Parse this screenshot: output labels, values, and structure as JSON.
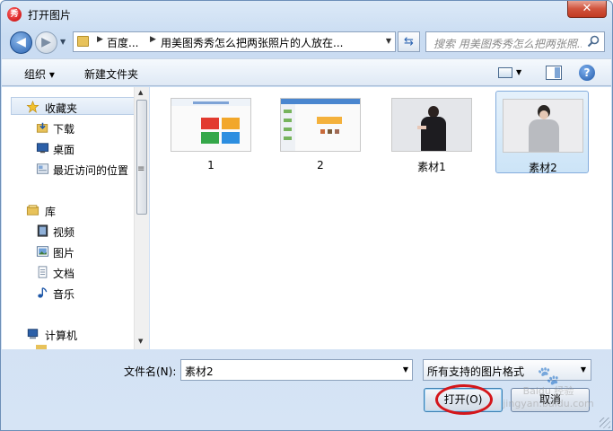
{
  "window": {
    "title": "打开图片",
    "app_icon_label": "秀",
    "close_label": "✕"
  },
  "address": {
    "segments": [
      "百度...",
      "用美图秀秀怎么把两张照片的人放在..."
    ]
  },
  "search": {
    "placeholder": "搜索 用美图秀秀怎么把两张照..."
  },
  "toolbar": {
    "organize_label": "组织 ▾",
    "new_folder_label": "新建文件夹"
  },
  "sidebar": {
    "favorites": {
      "label": "收藏夹",
      "icon": "star-icon"
    },
    "fav_items": [
      {
        "label": "下载",
        "icon": "download-folder-icon"
      },
      {
        "label": "桌面",
        "icon": "desktop-icon"
      },
      {
        "label": "最近访问的位置",
        "icon": "recent-places-icon"
      }
    ],
    "libraries": {
      "label": "库",
      "icon": "library-icon"
    },
    "lib_items": [
      {
        "label": "视频",
        "icon": "video-icon"
      },
      {
        "label": "图片",
        "icon": "pictures-icon"
      },
      {
        "label": "文档",
        "icon": "documents-icon"
      },
      {
        "label": "音乐",
        "icon": "music-icon"
      }
    ],
    "computer": {
      "label": "计算机",
      "icon": "computer-icon"
    },
    "scroll_marker": "≡"
  },
  "files": [
    {
      "name": "1",
      "kind": "screenshot-colorful-buttons"
    },
    {
      "name": "2",
      "kind": "screenshot-app-ui"
    },
    {
      "name": "素材1",
      "kind": "photo-woman"
    },
    {
      "name": "素材2",
      "kind": "photo-man",
      "selected": true
    }
  ],
  "bottom": {
    "filename_label": "文件名(N):",
    "filename_value": "素材2",
    "filetype_value": "所有支持的图片格式",
    "open_label": "打开(O)",
    "cancel_label": "取消"
  },
  "watermark": {
    "line1": "Baidu 经验",
    "line2": "jingyan.baidu.com"
  },
  "colors": {
    "selection_bg": "#cce4f7",
    "selection_border": "#84acdd",
    "highlight_circle": "#d4161b"
  }
}
